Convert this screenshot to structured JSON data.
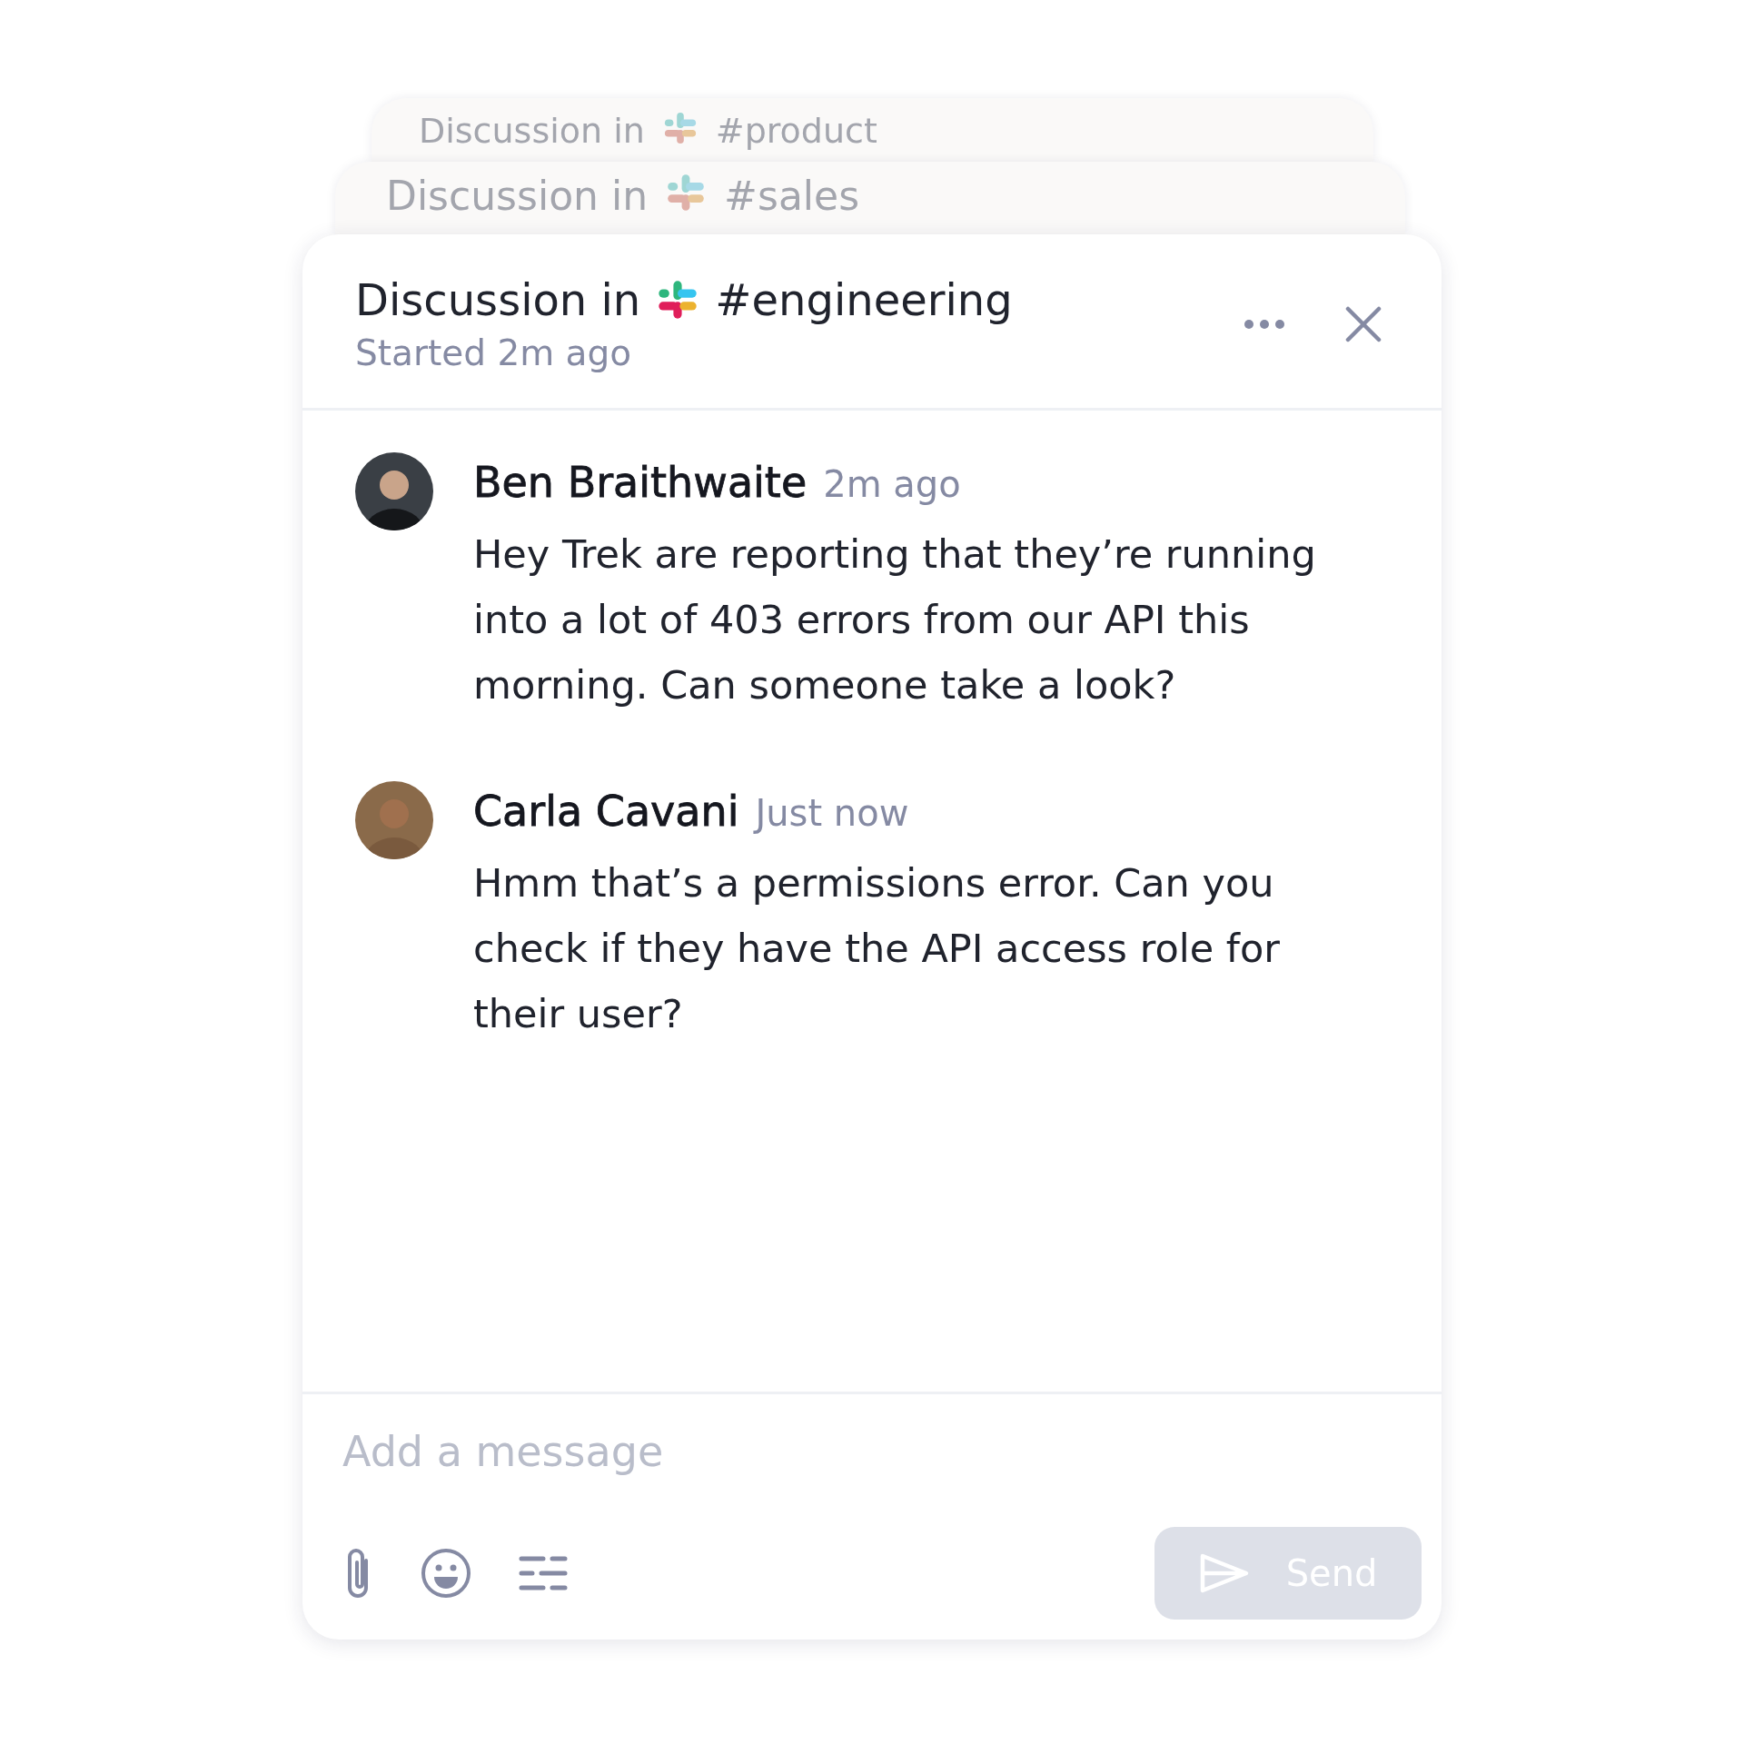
{
  "stacked_threads": [
    {
      "prefix": "Discussion in",
      "channel": "#product"
    },
    {
      "prefix": "Discussion in",
      "channel": "#sales"
    }
  ],
  "thread": {
    "prefix": "Discussion in",
    "channel": "#engineering",
    "subtitle": "Started 2m ago"
  },
  "messages": [
    {
      "author": "Ben Braithwaite",
      "time": "2m ago",
      "text": "Hey Trek are reporting that they’re running into a lot of 403 errors from our API this morning. Can someone take a look?"
    },
    {
      "author": "Carla Cavani",
      "time": "Just now",
      "text": "Hmm that’s a permissions error. Can you check if they have the API access role for their user?"
    }
  ],
  "composer": {
    "placeholder": "Add a message"
  },
  "send_button": {
    "label": "Send",
    "disabled": true
  }
}
